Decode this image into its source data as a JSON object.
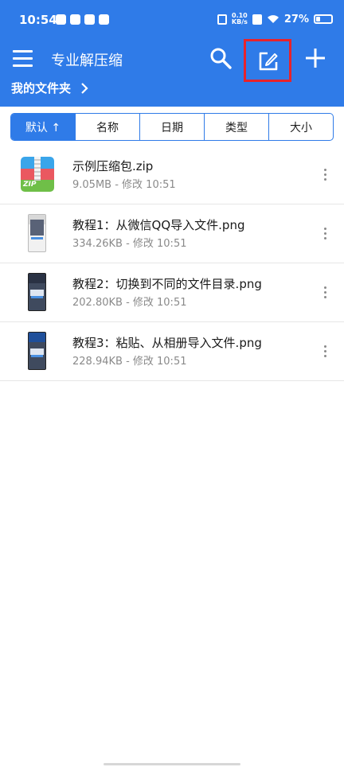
{
  "status_bar": {
    "time": "10:54",
    "net_speed_value": "0.10",
    "net_speed_unit": "KB/s",
    "battery": "27%",
    "battery_fraction": 0.27
  },
  "app_bar": {
    "title": "专业解压缩",
    "icons": [
      "menu-icon",
      "search-icon",
      "edit-icon",
      "plus-icon"
    ]
  },
  "breadcrumb": {
    "label": "我的文件夹"
  },
  "sort_tabs": [
    {
      "label": "默认 ↑",
      "active": true
    },
    {
      "label": "名称",
      "active": false
    },
    {
      "label": "日期",
      "active": false
    },
    {
      "label": "类型",
      "active": false
    },
    {
      "label": "大小",
      "active": false
    }
  ],
  "files": [
    {
      "name": "示例压缩包.zip",
      "meta": "9.05MB - 修改 10:51",
      "thumb_label": "ZIP",
      "thumb_type": "zip"
    },
    {
      "name": "教程1：从微信QQ导入文件.png",
      "meta": "334.26KB - 修改 10:51",
      "thumb_type": "image"
    },
    {
      "name": "教程2：切换到不同的文件目录.png",
      "meta": "202.80KB - 修改 10:51",
      "thumb_type": "image"
    },
    {
      "name": "教程3：粘贴、从相册导入文件.png",
      "meta": "228.94KB - 修改 10:51",
      "thumb_type": "image"
    }
  ],
  "colors": {
    "primary": "#2f7be8",
    "highlight_box": "#e8232b"
  }
}
